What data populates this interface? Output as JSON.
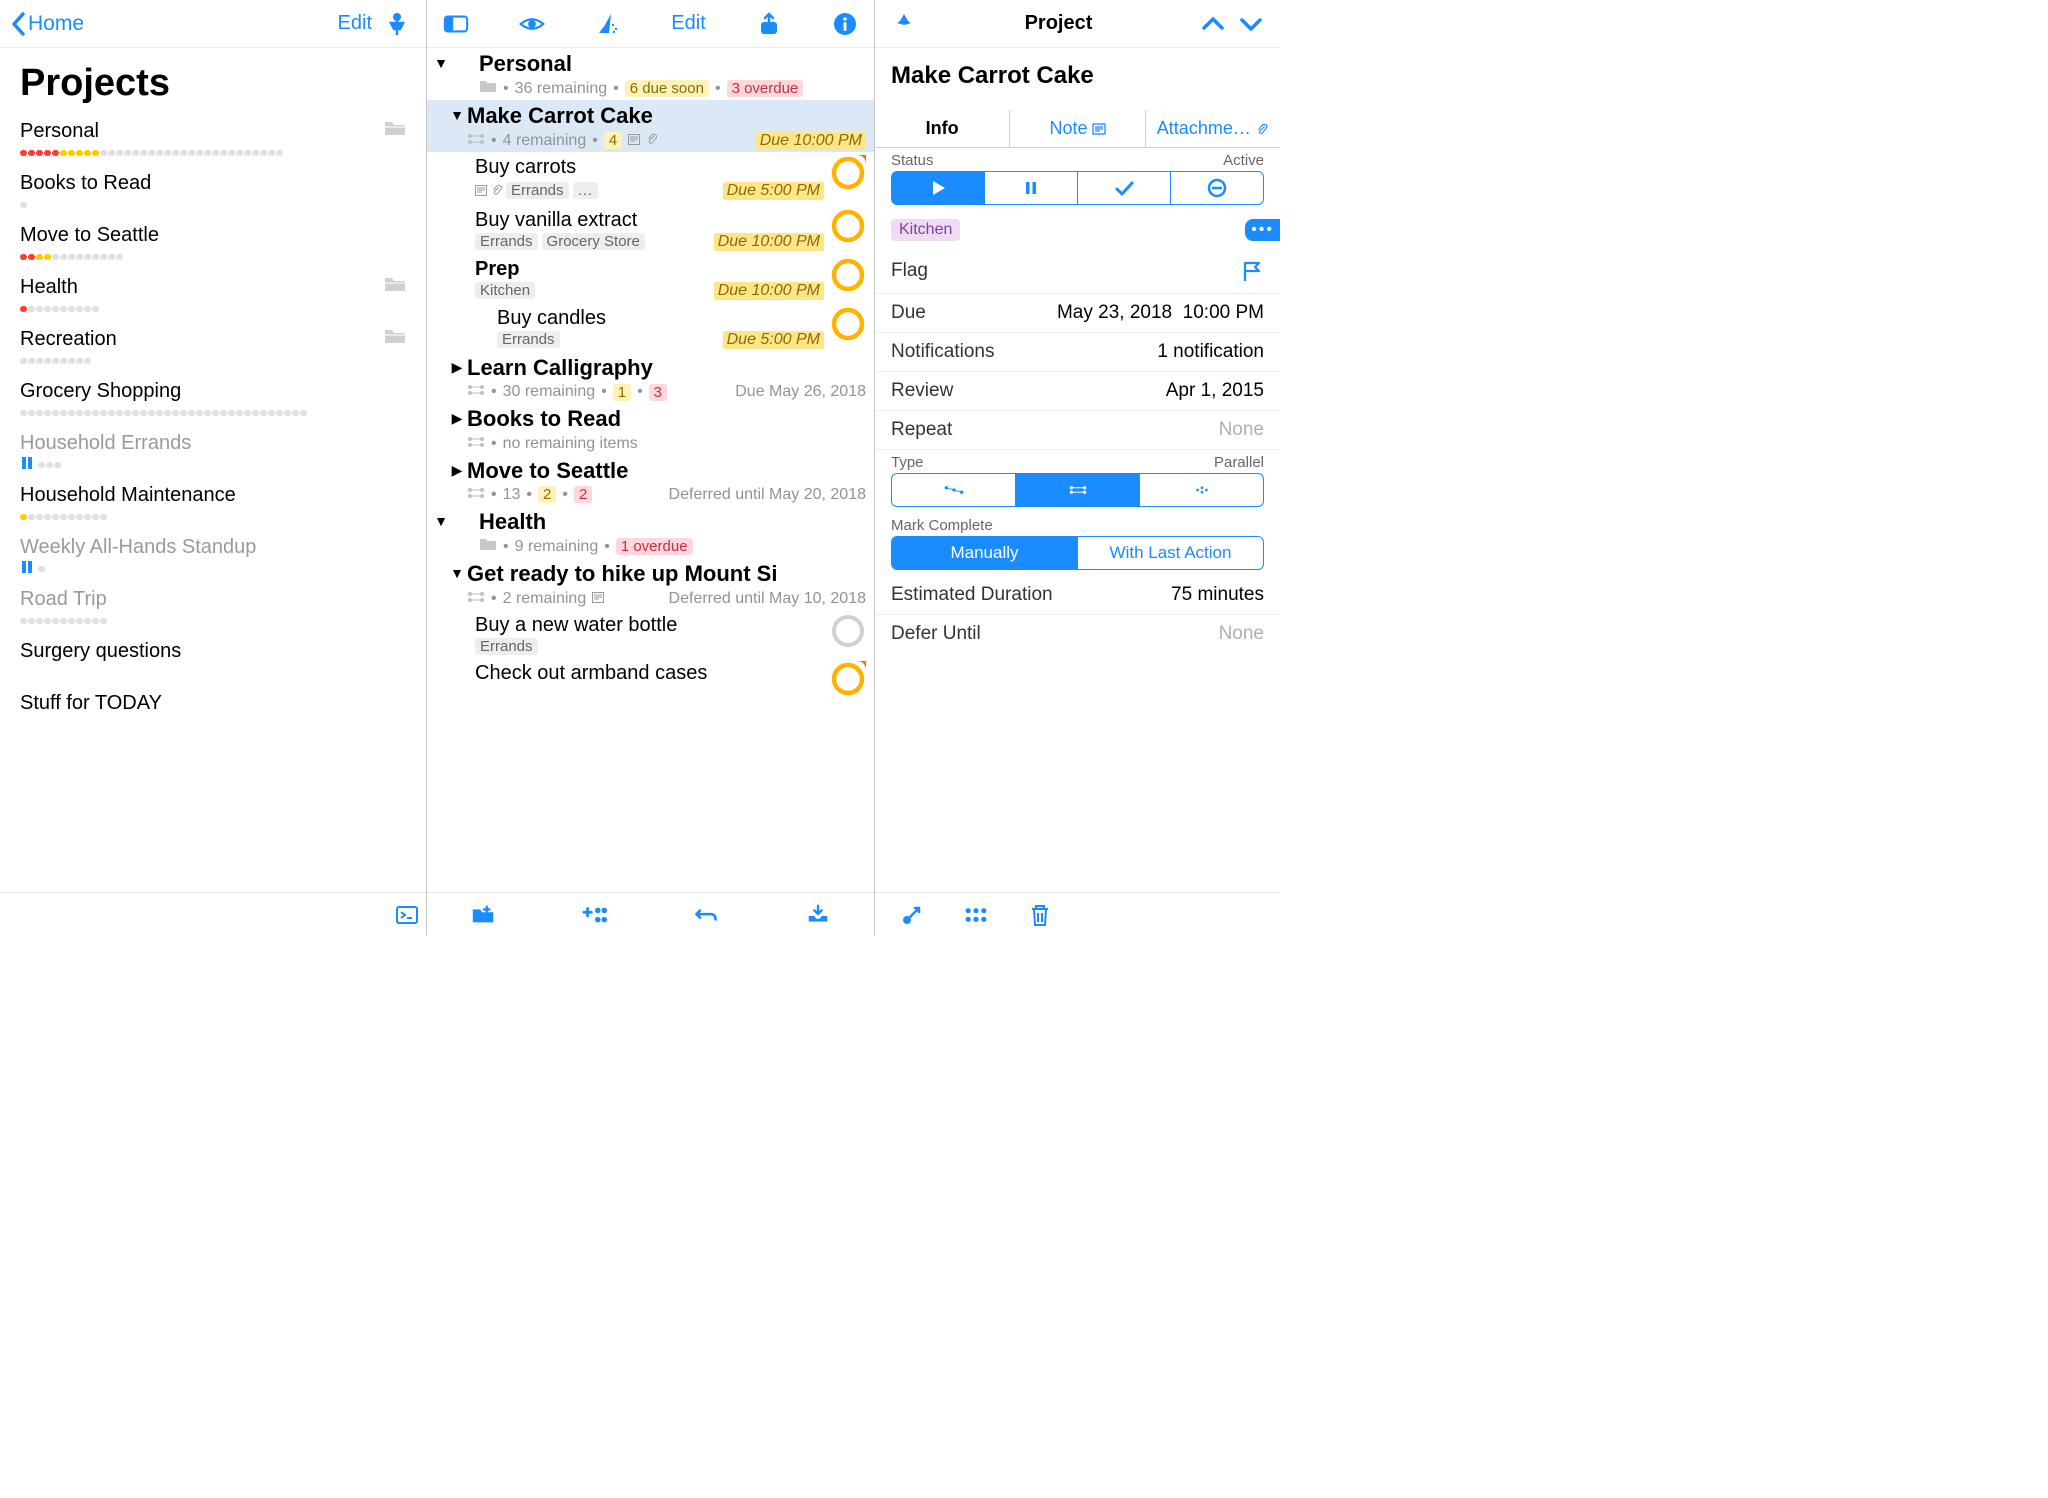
{
  "col1": {
    "back_label": "Home",
    "edit_label": "Edit",
    "title": "Projects",
    "projects": [
      {
        "name": "Personal",
        "folder": true,
        "dots": "rrrrryyyyy-----------------------"
      },
      {
        "name": "Books to Read",
        "folder": false,
        "dots": "-"
      },
      {
        "name": "Move to Seattle",
        "folder": false,
        "dots": "rryy---------"
      },
      {
        "name": "Health",
        "folder": true,
        "dots": "r---------"
      },
      {
        "name": "Recreation",
        "folder": true,
        "dots": "---------"
      },
      {
        "name": "Grocery Shopping",
        "folder": false,
        "dots": "------------------------------------"
      },
      {
        "name": "Household Errands",
        "folder": false,
        "dim": true,
        "paused": true,
        "dots": "---"
      },
      {
        "name": "Household Maintenance",
        "folder": false,
        "dots": "y----------"
      },
      {
        "name": "Weekly All-Hands Standup",
        "folder": false,
        "dim": true,
        "paused": true,
        "dots": "-"
      },
      {
        "name": "Road Trip",
        "folder": false,
        "dim": true,
        "dots": "-----------"
      },
      {
        "name": "Surgery questions",
        "folder": false,
        "dots": ""
      },
      {
        "name": "Stuff for TODAY",
        "folder": false,
        "dots": ""
      }
    ]
  },
  "col2": {
    "edit_label": "Edit",
    "groups": [
      {
        "title": "Personal",
        "open": true,
        "folder": true,
        "sub_remaining": "36 remaining",
        "due_soon": "6 due soon",
        "overdue": "3 overdue",
        "children": [
          {
            "type": "project",
            "title": "Make Carrot Cake",
            "selected": true,
            "open": true,
            "sub_remaining": "4 remaining",
            "due_soon_n": "4",
            "note_icon": true,
            "attach_icon": true,
            "due_badge": "Due 10:00 PM",
            "tasks": [
              {
                "title": "Buy carrots",
                "tags": [
                  "Errands",
                  "…"
                ],
                "note_icon": true,
                "attach_icon": true,
                "due_badge": "Due 5:00 PM",
                "circle": "amber_corner"
              },
              {
                "title": "Buy vanilla extract",
                "tags": [
                  "Errands",
                  "Grocery Store"
                ],
                "due_badge": "Due 10:00 PM",
                "circle": "amber"
              },
              {
                "title": "Prep",
                "bold": true,
                "tags": [
                  "Kitchen"
                ],
                "due_badge": "Due 10:00 PM",
                "circle": "amber"
              },
              {
                "title": "Buy candles",
                "indent": true,
                "tags": [
                  "Errands"
                ],
                "due_badge": "Due 5:00 PM",
                "circle": "amber"
              }
            ]
          },
          {
            "type": "project",
            "title": "Learn Calligraphy",
            "open": false,
            "sub_remaining": "30 remaining",
            "due_soon_n": "1",
            "overdue_n": "3",
            "due_gray": "Due May 26, 2018"
          },
          {
            "type": "project",
            "title": "Books to Read",
            "open": false,
            "sub_remaining": "no remaining items"
          },
          {
            "type": "project",
            "title": "Move to Seattle",
            "open": false,
            "sub_remaining": "13",
            "due_soon_n": "2",
            "overdue_n": "2",
            "due_gray": "Deferred until May 20, 2018"
          }
        ]
      },
      {
        "title": "Health",
        "open": true,
        "folder": true,
        "sub_remaining": "9 remaining",
        "overdue": "1 overdue",
        "children": [
          {
            "type": "project",
            "title": "Get ready to hike up Mount Si",
            "open": true,
            "sub_remaining": "2 remaining",
            "note_icon": true,
            "due_gray": "Deferred until May 10, 2018",
            "tasks": [
              {
                "title": "Buy a new water bottle",
                "tags": [
                  "Errands"
                ],
                "circle": "gray"
              },
              {
                "title": "Check out armband cases",
                "circle": "amber_corner"
              }
            ]
          }
        ]
      }
    ]
  },
  "col3": {
    "title": "Project",
    "item_title": "Make Carrot Cake",
    "tabs": {
      "info": "Info",
      "note": "Note",
      "attach": "Attachme…"
    },
    "status_label": "Status",
    "status_value": "Active",
    "tag": "Kitchen",
    "flag_label": "Flag",
    "due_label": "Due",
    "due_date": "May 23, 2018",
    "due_time": "10:00 PM",
    "notif_label": "Notifications",
    "notif_value": "1 notification",
    "review_label": "Review",
    "review_value": "Apr 1, 2015",
    "repeat_label": "Repeat",
    "repeat_value": "None",
    "type_label": "Type",
    "type_value": "Parallel",
    "mark_label": "Mark Complete",
    "mark_manual": "Manually",
    "mark_last": "With Last Action",
    "est_label": "Estimated Duration",
    "est_value": "75 minutes",
    "defer_label": "Defer Until",
    "defer_value": "None"
  }
}
